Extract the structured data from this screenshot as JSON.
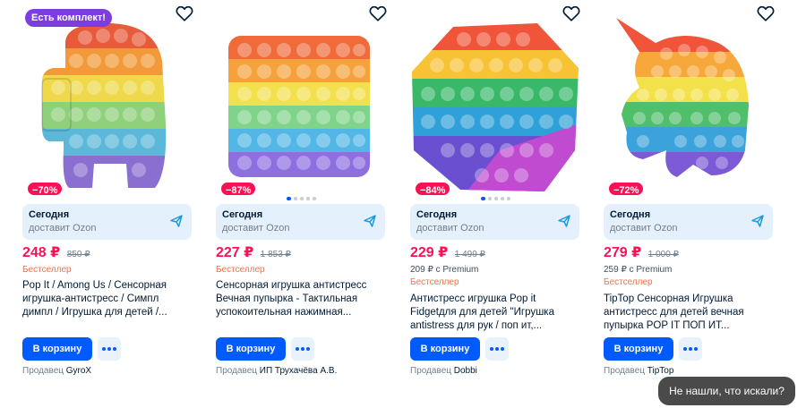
{
  "products": [
    {
      "set_badge": "Есть комплект!",
      "discount": "−70%",
      "delivery_when": "Сегодня",
      "delivery_who": "доставит Ozon",
      "price": "248 ₽",
      "old_price": "850 ₽",
      "premium": "",
      "bestseller": "Бестселлер",
      "title_lines": [
        "Pop It / Among Us / Сенсорная",
        "игрушка-антистресс / Симпл",
        "димпл / Игрушка для детей /..."
      ],
      "cart_label": "В корзину",
      "seller_prefix": "Продавец",
      "seller_name": "GyroX",
      "image": "among-us-pop-it"
    },
    {
      "set_badge": "",
      "discount": "−87%",
      "delivery_when": "Сегодня",
      "delivery_who": "доставит Ozon",
      "price": "227 ₽",
      "old_price": "1 853 ₽",
      "premium": "",
      "bestseller": "Бестселлер",
      "title_lines": [
        "Сенсорная игрушка антистресс",
        "Вечная пупырка - Тактильная",
        "успокоительная нажимная..."
      ],
      "cart_label": "В корзину",
      "seller_prefix": "Продавец",
      "seller_name": "ИП Трухачёва А.В.",
      "image": "square-pop-it"
    },
    {
      "set_badge": "",
      "discount": "−84%",
      "delivery_when": "Сегодня",
      "delivery_who": "доставит Ozon",
      "price": "229 ₽",
      "old_price": "1 499 ₽",
      "premium": "209 ₽ с Premium",
      "bestseller": "Бестселлер",
      "title_lines": [
        "Антистресс игрушка Pop it",
        "Fidgetдля для детей \"Игрушка",
        "antistress для рук / поп ит,..."
      ],
      "cart_label": "В корзину",
      "seller_prefix": "Продавец",
      "seller_name": "Dobbi",
      "image": "octagon-pop-it"
    },
    {
      "set_badge": "",
      "discount": "−72%",
      "delivery_when": "Сегодня",
      "delivery_who": "доставит Ozon",
      "price": "279 ₽",
      "old_price": "1 000 ₽",
      "premium": "259 ₽ с Premium",
      "bestseller": "Бестселлер",
      "title_lines": [
        "TipTop Сенсорная Игрушка",
        "антистресс для детей вечная",
        "пупырка POP IT ПОП ИТ..."
      ],
      "cart_label": "В корзину",
      "seller_prefix": "Продавец",
      "seller_name": "TipTop",
      "image": "unicorn-pop-it"
    }
  ],
  "help_button": "Не нашли, что искали?",
  "colors": {
    "brand_blue": "#005bff",
    "price_pink": "#f91155",
    "bestseller_orange": "#f4724b",
    "set_badge_purple": "#7b3ce0",
    "delivery_bg": "#e4f1fd"
  }
}
